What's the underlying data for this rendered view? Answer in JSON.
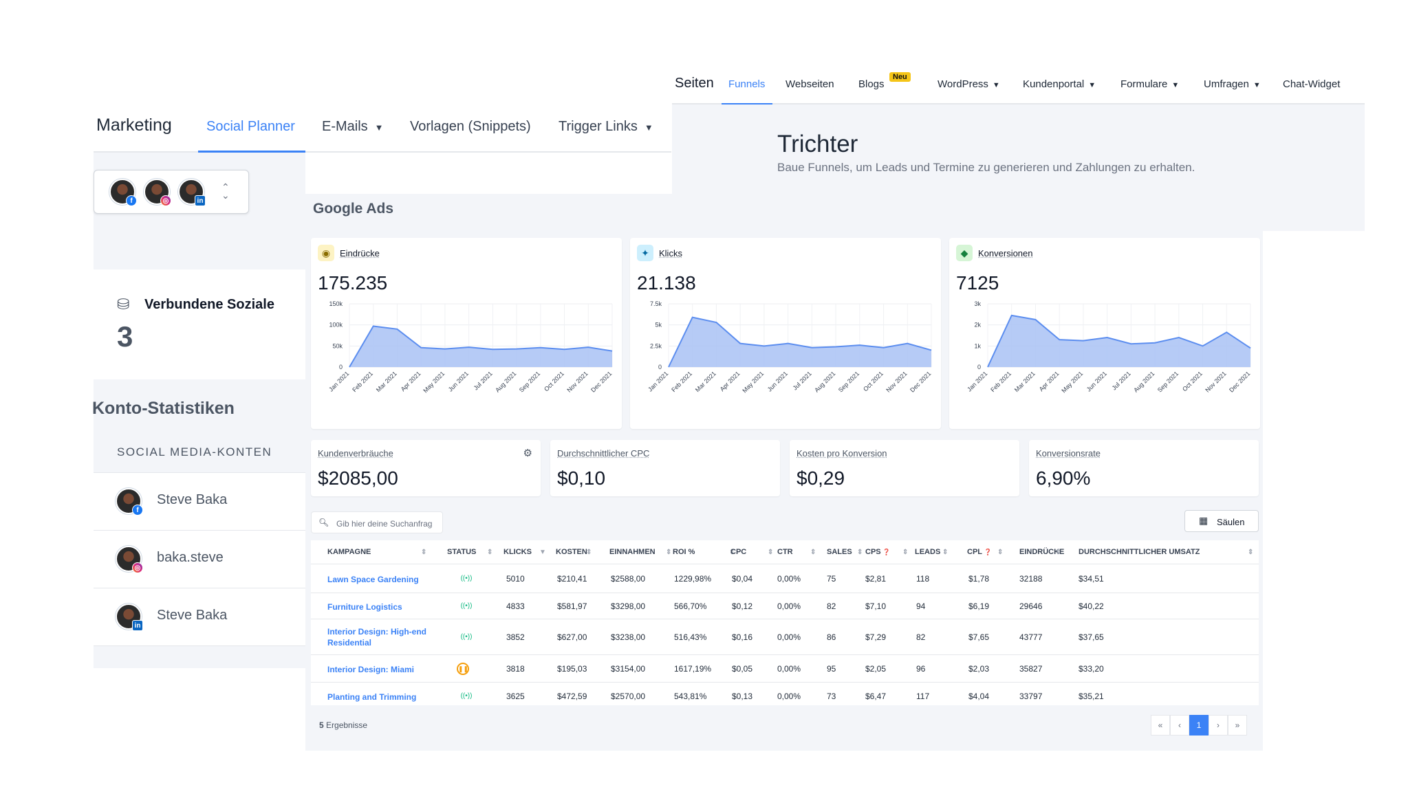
{
  "funnels": {
    "nav_title": "Seiten",
    "nav_items": [
      {
        "label": "Funnels"
      },
      {
        "label": "Webseiten"
      },
      {
        "label": "Blogs"
      },
      {
        "label": "WordPress"
      },
      {
        "label": "Kundenportal"
      },
      {
        "label": "Formulare"
      },
      {
        "label": "Umfragen"
      },
      {
        "label": "Chat-Widget"
      }
    ],
    "new_badge": "Neu",
    "heading": "Trichter",
    "subheading": "Baue Funnels, um Leads und Termine zu generieren und Zahlungen zu erhalten."
  },
  "marketing": {
    "title": "Marketing",
    "tabs": [
      {
        "label": "Social Planner"
      },
      {
        "label": "E-Mails"
      },
      {
        "label": "Vorlagen (Snippets)"
      },
      {
        "label": "Trigger Links"
      }
    ],
    "connected_label": "Verbundene Soziale",
    "connected_count": "3",
    "account_stats_title": "Konto-Statistiken",
    "social_accounts_header": "SOCIAL MEDIA-KONTEN",
    "accounts": [
      {
        "name": "Steve Baka",
        "network": "facebook"
      },
      {
        "name": "baka.steve",
        "network": "instagram"
      },
      {
        "name": "Steve Baka",
        "network": "linkedin"
      }
    ]
  },
  "ads": {
    "title": "Google Ads",
    "metric_cards": [
      {
        "label": "Eindrücke",
        "value": "175.235",
        "icon": "eye-icon",
        "icon_bg": "#fdf3c4"
      },
      {
        "label": "Klicks",
        "value": "21.138",
        "icon": "cursor-click-icon",
        "icon_bg": "#cdeffd"
      },
      {
        "label": "Konversionen",
        "value": "7125",
        "icon": "diamond-icon",
        "icon_bg": "#d6f5d6"
      }
    ],
    "kpis": [
      {
        "label": "Kundenverbräuche",
        "value": "$2085,00"
      },
      {
        "label": "Durchschnittlicher CPC",
        "value": "$0,10"
      },
      {
        "label": "Kosten pro Konversion",
        "value": "$0,29"
      },
      {
        "label": "Konversionsrate",
        "value": "6,90%"
      }
    ],
    "search_placeholder": "Gib hier deine Suchanfrag",
    "columns_button": "Säulen",
    "columns": [
      "KAMPAGNE",
      "STATUS",
      "KLICKS",
      "KOSTEN",
      "EINNAHMEN",
      "ROI %",
      "CPC",
      "CTR",
      "SALES",
      "CPS",
      "LEADS",
      "CPL",
      "EINDRÜCKE",
      "DURCHSCHNITTLICHER UMSATZ"
    ],
    "rows": [
      {
        "kampagne": "Lawn Space Gardening",
        "status": "live",
        "klicks": "5010",
        "kosten": "$210,41",
        "einnahmen": "$2588,00",
        "roi": "1229,98%",
        "cpc": "$0,04",
        "ctr": "0,00%",
        "sales": "75",
        "cps": "$2,81",
        "leads": "118",
        "cpl": "$1,78",
        "eindruecke": "32188",
        "umsatz": "$34,51"
      },
      {
        "kampagne": "Furniture Logistics",
        "status": "live",
        "klicks": "4833",
        "kosten": "$581,97",
        "einnahmen": "$3298,00",
        "roi": "566,70%",
        "cpc": "$0,12",
        "ctr": "0,00%",
        "sales": "82",
        "cps": "$7,10",
        "leads": "94",
        "cpl": "$6,19",
        "eindruecke": "29646",
        "umsatz": "$40,22"
      },
      {
        "kampagne": "Interior Design: High-end Residential",
        "status": "live",
        "klicks": "3852",
        "kosten": "$627,00",
        "einnahmen": "$3238,00",
        "roi": "516,43%",
        "cpc": "$0,16",
        "ctr": "0,00%",
        "sales": "86",
        "cps": "$7,29",
        "leads": "82",
        "cpl": "$7,65",
        "eindruecke": "43777",
        "umsatz": "$37,65"
      },
      {
        "kampagne": "Interior Design: Miami",
        "status": "paused",
        "klicks": "3818",
        "kosten": "$195,03",
        "einnahmen": "$3154,00",
        "roi": "1617,19%",
        "cpc": "$0,05",
        "ctr": "0,00%",
        "sales": "95",
        "cps": "$2,05",
        "leads": "96",
        "cpl": "$2,03",
        "eindruecke": "35827",
        "umsatz": "$33,20"
      },
      {
        "kampagne": "Planting and Trimming",
        "status": "live",
        "klicks": "3625",
        "kosten": "$472,59",
        "einnahmen": "$2570,00",
        "roi": "543,81%",
        "cpc": "$0,13",
        "ctr": "0,00%",
        "sales": "73",
        "cps": "$6,47",
        "leads": "117",
        "cpl": "$4,04",
        "eindruecke": "33797",
        "umsatz": "$35,21"
      }
    ],
    "results_count": "5",
    "results_label": "Ergebnisse",
    "pagination": [
      "«",
      "‹",
      "1",
      "›",
      "»"
    ],
    "current_page": "1"
  },
  "chart_data": [
    {
      "type": "area",
      "title": "Eindrücke",
      "categories": [
        "Jan 2021",
        "Feb 2021",
        "Mar 2021",
        "Apr 2021",
        "May 2021",
        "Jun 2021",
        "Jul 2021",
        "Aug 2021",
        "Sep 2021",
        "Oct 2021",
        "Nov 2021",
        "Dec 2021"
      ],
      "series": [
        {
          "values": [
            0,
            97000,
            90000,
            46000,
            43000,
            47000,
            42000,
            43000,
            46000,
            42000,
            47000,
            38000
          ]
        }
      ],
      "ylim": [
        0,
        150000
      ],
      "yticks": [
        "0",
        "50k",
        "100k",
        "150k"
      ],
      "color": "#5b8def"
    },
    {
      "type": "area",
      "title": "Klicks",
      "categories": [
        "Jan 2021",
        "Feb 2021",
        "Mar 2021",
        "Apr 2021",
        "May 2021",
        "Jun 2021",
        "Jul 2021",
        "Aug 2021",
        "Sep 2021",
        "Oct 2021",
        "Nov 2021",
        "Dec 2021"
      ],
      "series": [
        {
          "values": [
            0,
            5900,
            5300,
            2800,
            2500,
            2800,
            2300,
            2400,
            2600,
            2300,
            2800,
            2000
          ]
        }
      ],
      "ylim": [
        0,
        7500
      ],
      "yticks": [
        "0",
        "2.5k",
        "5k",
        "7.5k"
      ],
      "color": "#5b8def"
    },
    {
      "type": "area",
      "title": "Konversionen",
      "categories": [
        "Jan 2021",
        "Feb 2021",
        "Mar 2021",
        "Apr 2021",
        "May 2021",
        "Jun 2021",
        "Jul 2021",
        "Aug 2021",
        "Sep 2021",
        "Oct 2021",
        "Nov 2021",
        "Dec 2021"
      ],
      "series": [
        {
          "values": [
            0,
            2450,
            2250,
            1300,
            1250,
            1400,
            1100,
            1150,
            1400,
            1000,
            1650,
            900
          ]
        }
      ],
      "ylim": [
        0,
        3000
      ],
      "yticks": [
        "0",
        "1k",
        "2k",
        "3k"
      ],
      "color": "#5b8def"
    }
  ]
}
